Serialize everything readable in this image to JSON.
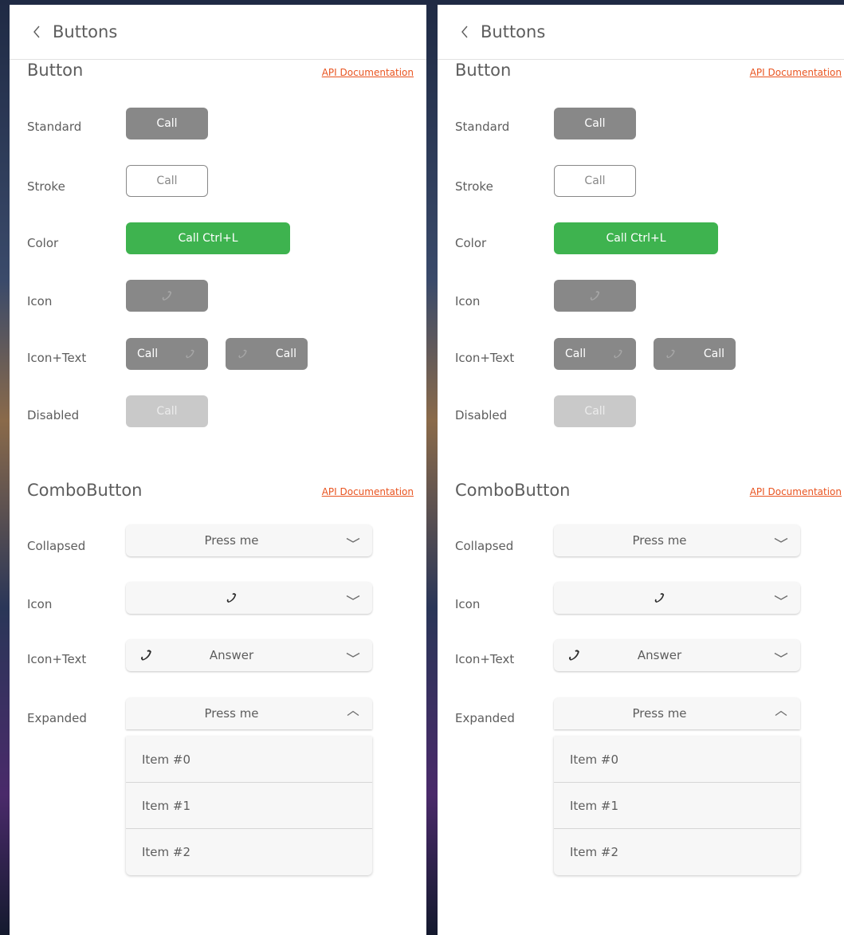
{
  "header": {
    "title": "Buttons"
  },
  "button_section": {
    "title": "Button",
    "api_link": "API Documentation",
    "rows": {
      "standard": {
        "label": "Standard",
        "button": "Call"
      },
      "stroke": {
        "label": "Stroke",
        "button": "Call"
      },
      "color": {
        "label": "Color",
        "button": "Call Ctrl+L"
      },
      "icon": {
        "label": "Icon",
        "icon": "phone-icon"
      },
      "icon_text": {
        "label": "Icon+Text",
        "button_a": "Call",
        "button_b": "Call",
        "icon": "phone-icon"
      },
      "disabled": {
        "label": "Disabled",
        "button": "Call"
      }
    }
  },
  "combo_section": {
    "title": "ComboButton",
    "api_link": "API Documentation",
    "rows": {
      "collapsed": {
        "label": "Collapsed",
        "text": "Press me"
      },
      "icon": {
        "label": "Icon",
        "icon": "phone-icon"
      },
      "icon_text": {
        "label": "Icon+Text",
        "text": "Answer",
        "icon": "phone-icon"
      },
      "expanded": {
        "label": "Expanded",
        "text": "Press me",
        "items": [
          "Item #0",
          "Item #1",
          "Item #2"
        ]
      }
    }
  },
  "colors": {
    "standard": "#888888",
    "positive": "#3eb34f",
    "disabled": "#c9c9c9",
    "link": "#e95420",
    "text": "#5d5d5d"
  }
}
